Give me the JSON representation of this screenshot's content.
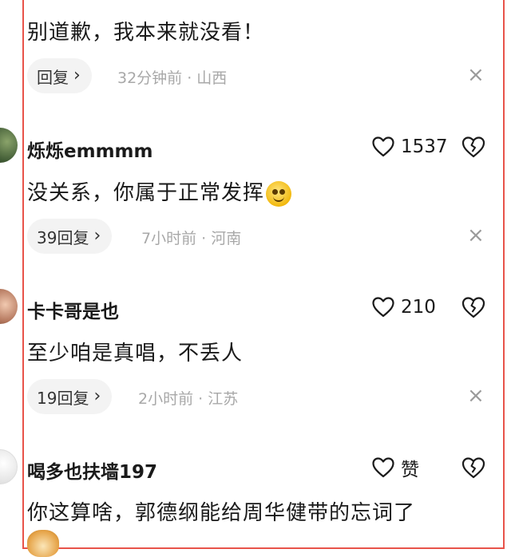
{
  "comments": [
    {
      "text": "别道歉，我本来就没看！",
      "reply_label": "回复",
      "meta": "32分钟前 · 山西"
    },
    {
      "username": "烁烁emmmm",
      "likes": "1537",
      "text": "没关系，你属于正常发挥",
      "reply_label": "39回复",
      "meta": "7小时前 · 河南"
    },
    {
      "username": "卡卡哥是也",
      "likes": "210",
      "text": "至少咱是真唱，不丢人",
      "reply_label": "19回复",
      "meta": "2小时前 · 江苏"
    },
    {
      "username": "喝多也扶墙197",
      "likes": "赞",
      "text": "你这算啥，郭德纲能给周华健带的忘词了"
    }
  ],
  "icons": {
    "close": "×",
    "chevron": "›"
  }
}
